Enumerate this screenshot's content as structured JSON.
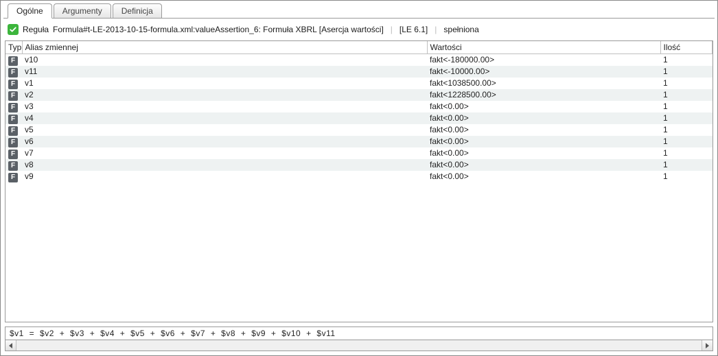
{
  "tabs": {
    "general": "Ogólne",
    "arguments": "Argumenty",
    "definition": "Definicja",
    "active": "general"
  },
  "rule": {
    "prefix": "Reguła",
    "name": "Formula#t-LE-2013-10-15-formula.xml:valueAssertion_6: Formuła XBRL [Asercja wartości]",
    "code": "[LE 6.1]",
    "status": "spełniona",
    "status_ok": true
  },
  "columns": {
    "type": "Typ",
    "alias": "Alias zmiennej",
    "values": "Wartości",
    "count": "Ilość"
  },
  "type_badge_letter": "F",
  "rows": [
    {
      "alias": "v10",
      "value": "fakt<-180000.00>",
      "count": "1"
    },
    {
      "alias": "v11",
      "value": "fakt<-10000.00>",
      "count": "1"
    },
    {
      "alias": "v1",
      "value": "fakt<1038500.00>",
      "count": "1"
    },
    {
      "alias": "v2",
      "value": "fakt<1228500.00>",
      "count": "1"
    },
    {
      "alias": "v3",
      "value": "fakt<0.00>",
      "count": "1"
    },
    {
      "alias": "v4",
      "value": "fakt<0.00>",
      "count": "1"
    },
    {
      "alias": "v5",
      "value": "fakt<0.00>",
      "count": "1"
    },
    {
      "alias": "v6",
      "value": "fakt<0.00>",
      "count": "1"
    },
    {
      "alias": "v7",
      "value": "fakt<0.00>",
      "count": "1"
    },
    {
      "alias": "v8",
      "value": "fakt<0.00>",
      "count": "1"
    },
    {
      "alias": "v9",
      "value": "fakt<0.00>",
      "count": "1"
    }
  ],
  "formula": "$v1  =  $v2  +  $v3  +  $v4  +  $v5  +  $v6  +  $v7  +  $v8  +  $v9  +  $v10  +  $v11"
}
